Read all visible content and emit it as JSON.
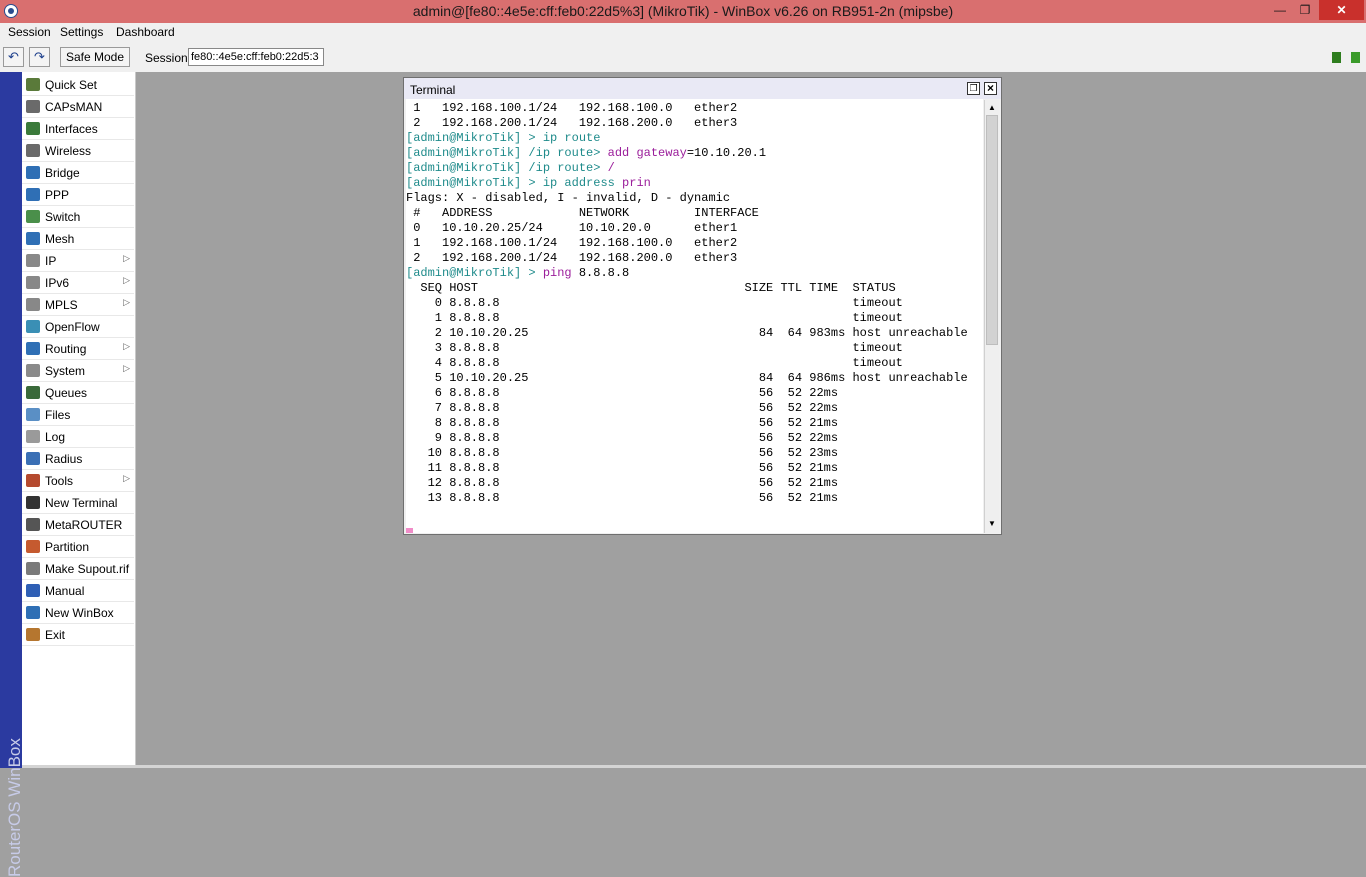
{
  "window": {
    "title": "admin@[fe80::4e5e:cff:feb0:22d5%3] (MikroTik) - WinBox v6.26 on RB951-2n (mipsbe)",
    "minimize_glyph": "—",
    "maximize_glyph": "❐",
    "close_glyph": "✕"
  },
  "menubar": {
    "session": "Session",
    "settings": "Settings",
    "dashboard": "Dashboard"
  },
  "toolbar": {
    "undo_glyph": "↶",
    "redo_glyph": "↷",
    "safe_mode": "Safe Mode",
    "session_label": "Session:",
    "session_value": "fe80::4e5e:cff:feb0:22d5:3"
  },
  "sidebar": {
    "brand": "RouterOS WinBox",
    "items": [
      {
        "label": "Quick Set",
        "icon": "quick-set-icon",
        "color": "#5a7a3a",
        "submenu": false
      },
      {
        "label": "CAPsMAN",
        "icon": "capsman-icon",
        "color": "#6a6a6a",
        "submenu": false
      },
      {
        "label": "Interfaces",
        "icon": "interfaces-icon",
        "color": "#3a7a3a",
        "submenu": false
      },
      {
        "label": "Wireless",
        "icon": "wireless-icon",
        "color": "#6a6a6a",
        "submenu": false
      },
      {
        "label": "Bridge",
        "icon": "bridge-icon",
        "color": "#2f6fb5",
        "submenu": false
      },
      {
        "label": "PPP",
        "icon": "ppp-icon",
        "color": "#2f6fb5",
        "submenu": false
      },
      {
        "label": "Switch",
        "icon": "switch-icon",
        "color": "#4a8f4a",
        "submenu": false
      },
      {
        "label": "Mesh",
        "icon": "mesh-icon",
        "color": "#2f6fb5",
        "submenu": false
      },
      {
        "label": "IP",
        "icon": "ip-icon",
        "color": "#888888",
        "submenu": true
      },
      {
        "label": "IPv6",
        "icon": "ipv6-icon",
        "color": "#888888",
        "submenu": true
      },
      {
        "label": "MPLS",
        "icon": "mpls-icon",
        "color": "#888888",
        "submenu": true
      },
      {
        "label": "OpenFlow",
        "icon": "openflow-icon",
        "color": "#3a8fb5",
        "submenu": false
      },
      {
        "label": "Routing",
        "icon": "routing-icon",
        "color": "#2f6fb5",
        "submenu": true
      },
      {
        "label": "System",
        "icon": "system-icon",
        "color": "#8a8a8a",
        "submenu": true
      },
      {
        "label": "Queues",
        "icon": "queues-icon",
        "color": "#3a6a3a",
        "submenu": false
      },
      {
        "label": "Files",
        "icon": "files-icon",
        "color": "#5a8fc5",
        "submenu": false
      },
      {
        "label": "Log",
        "icon": "log-icon",
        "color": "#9a9a9a",
        "submenu": false
      },
      {
        "label": "Radius",
        "icon": "radius-icon",
        "color": "#3a6fb5",
        "submenu": false
      },
      {
        "label": "Tools",
        "icon": "tools-icon",
        "color": "#b54a2f",
        "submenu": true
      },
      {
        "label": "New Terminal",
        "icon": "terminal-icon",
        "color": "#333333",
        "submenu": false
      },
      {
        "label": "MetaROUTER",
        "icon": "metarouter-icon",
        "color": "#555555",
        "submenu": false
      },
      {
        "label": "Partition",
        "icon": "partition-icon",
        "color": "#c55a2f",
        "submenu": false
      },
      {
        "label": "Make Supout.rif",
        "icon": "supout-icon",
        "color": "#7a7a7a",
        "submenu": false
      },
      {
        "label": "Manual",
        "icon": "manual-icon",
        "color": "#2f5fb5",
        "submenu": false
      },
      {
        "label": "New WinBox",
        "icon": "new-winbox-icon",
        "color": "#2f6fb5",
        "submenu": false
      },
      {
        "label": "Exit",
        "icon": "exit-icon",
        "color": "#b5762f",
        "submenu": false
      }
    ]
  },
  "terminal": {
    "title": "Terminal",
    "restore_glyph": "❐",
    "close_glyph": "×",
    "scroll_up_glyph": "▲",
    "scroll_down_glyph": "▼",
    "lines": [
      [
        {
          "t": " 1   192.168.100.1/24   192.168.100.0   ether2"
        }
      ],
      [
        {
          "t": " 2   192.168.200.1/24   192.168.200.0   ether3"
        }
      ],
      [
        {
          "t": "[admin@MikroTik] > ",
          "c": "prompt"
        },
        {
          "t": "ip route",
          "c": "prompt"
        }
      ],
      [
        {
          "t": "[admin@MikroTik] /ip route> ",
          "c": "prompt"
        },
        {
          "t": "add gateway",
          "c": "cmd"
        },
        {
          "t": "=10.10.20.1"
        }
      ],
      [
        {
          "t": "[admin@MikroTik] /ip route> ",
          "c": "prompt"
        },
        {
          "t": "/",
          "c": "cmd"
        }
      ],
      [
        {
          "t": "[admin@MikroTik] > ",
          "c": "prompt"
        },
        {
          "t": "ip address ",
          "c": "prompt"
        },
        {
          "t": "prin",
          "c": "cmd"
        }
      ],
      [
        {
          "t": "Flags: X - disabled, I - invalid, D - dynamic"
        }
      ],
      [
        {
          "t": " #   ADDRESS            NETWORK         INTERFACE"
        }
      ],
      [
        {
          "t": " 0   10.10.20.25/24     10.10.20.0      ether1"
        }
      ],
      [
        {
          "t": " 1   192.168.100.1/24   192.168.100.0   ether2"
        }
      ],
      [
        {
          "t": " 2   192.168.200.1/24   192.168.200.0   ether3"
        }
      ],
      [
        {
          "t": "[admin@MikroTik] > ",
          "c": "prompt"
        },
        {
          "t": "ping ",
          "c": "cmd"
        },
        {
          "t": "8.8.8.8"
        }
      ],
      [
        {
          "t": "  SEQ HOST                                     SIZE TTL TIME  STATUS"
        }
      ],
      [
        {
          "t": "    0 8.8.8.8                                                 timeout"
        }
      ],
      [
        {
          "t": "    1 8.8.8.8                                                 timeout"
        }
      ],
      [
        {
          "t": "    2 10.10.20.25                                84  64 983ms host unreachable"
        }
      ],
      [
        {
          "t": "    3 8.8.8.8                                                 timeout"
        }
      ],
      [
        {
          "t": "    4 8.8.8.8                                                 timeout"
        }
      ],
      [
        {
          "t": "    5 10.10.20.25                                84  64 986ms host unreachable"
        }
      ],
      [
        {
          "t": "    6 8.8.8.8                                    56  52 22ms"
        }
      ],
      [
        {
          "t": "    7 8.8.8.8                                    56  52 22ms"
        }
      ],
      [
        {
          "t": "    8 8.8.8.8                                    56  52 21ms"
        }
      ],
      [
        {
          "t": "    9 8.8.8.8                                    56  52 22ms"
        }
      ],
      [
        {
          "t": "   10 8.8.8.8                                    56  52 23ms"
        }
      ],
      [
        {
          "t": "   11 8.8.8.8                                    56  52 21ms"
        }
      ],
      [
        {
          "t": "   12 8.8.8.8                                    56  52 21ms"
        }
      ],
      [
        {
          "t": "   13 8.8.8.8                                    56  52 21ms"
        }
      ]
    ]
  }
}
